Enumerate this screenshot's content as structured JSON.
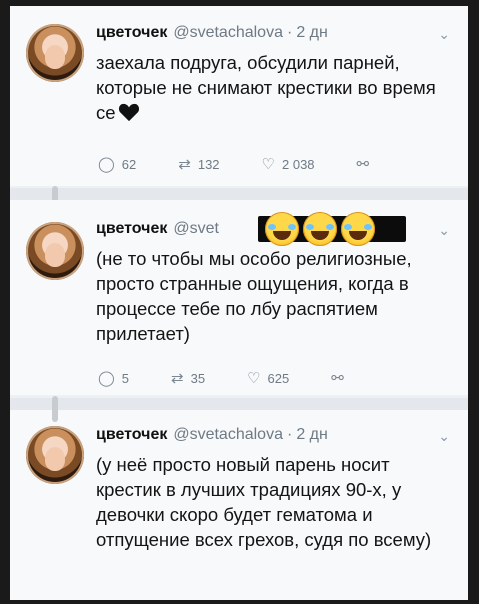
{
  "tweets": [
    {
      "name": "цветочек",
      "handle": "@svetachalova",
      "time": "2 дн",
      "text": "заехала подруга, обсудили парней, которые не снимают крестики во время се",
      "replies": "62",
      "retweets": "132",
      "likes": "2 038"
    },
    {
      "name": "цветочек",
      "handle": "@svet",
      "time": "",
      "text": "(не то чтобы мы особо религиозные, просто странные ощущения, когда в процессе тебе по лбу распятием прилетает)",
      "replies": "5",
      "retweets": "35",
      "likes": "625"
    },
    {
      "name": "цветочек",
      "handle": "@svetachalova",
      "time": "2 дн",
      "text": "(у неё просто новый парень носит крестик в лучших традициях 90-х, у девочки скоро будет гематома и отпущение всех грехов, судя по всему)",
      "replies": "",
      "retweets": "",
      "likes": ""
    }
  ],
  "icons": {
    "reply": "reply-icon",
    "retweet": "retweet-icon",
    "like": "heart-icon",
    "share": "share-icon",
    "more": "chevron-down-icon"
  },
  "colors": {
    "background": "#f7f9fa",
    "text": "#141414",
    "muted": "#6f7a85"
  }
}
